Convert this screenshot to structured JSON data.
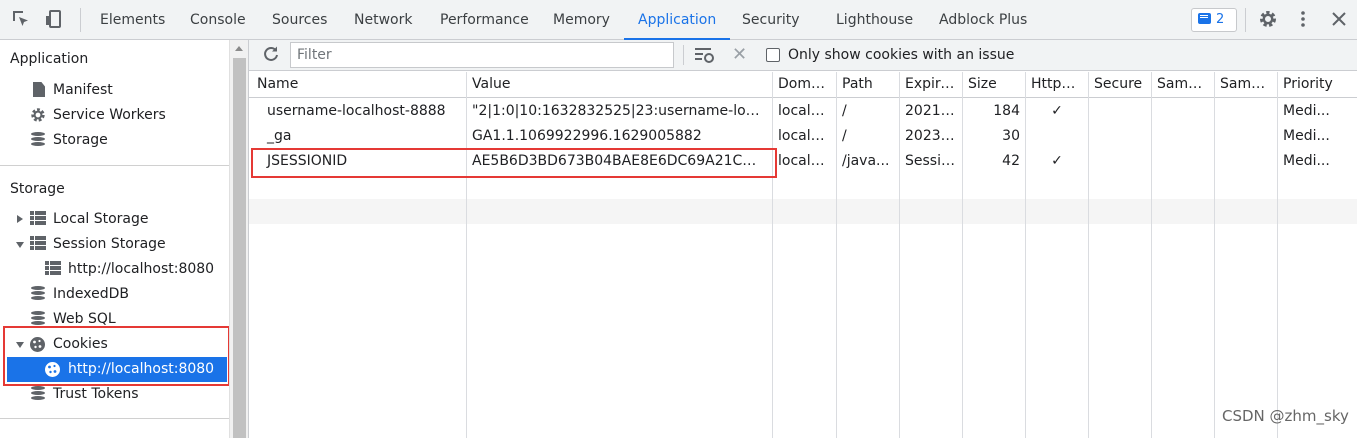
{
  "tabs": [
    "Elements",
    "Console",
    "Sources",
    "Network",
    "Performance",
    "Memory",
    "Application",
    "Security",
    "Lighthouse",
    "Adblock Plus"
  ],
  "active_tab": "Application",
  "issues_count": "2",
  "sidebar": {
    "section_application": "Application",
    "manifest": "Manifest",
    "service_workers": "Service Workers",
    "storage": "Storage",
    "section_storage": "Storage",
    "local_storage": "Local Storage",
    "session_storage": "Session Storage",
    "session_origin": "http://localhost:8080",
    "indexeddb": "IndexedDB",
    "websql": "Web SQL",
    "cookies": "Cookies",
    "cookies_origin": "http://localhost:8080",
    "trust_tokens": "Trust Tokens"
  },
  "toolbar": {
    "filter_placeholder": "Filter",
    "only_issues_label": "Only show cookies with an issue"
  },
  "table": {
    "columns": [
      "Name",
      "Value",
      "Domain",
      "Path",
      "Expire...",
      "Size",
      "HttpO...",
      "Secure",
      "Same...",
      "Same...",
      "Priority"
    ],
    "rows": [
      [
        "username-localhost-8888",
        "\"2|1:0|10:1632832525|23:username-localho...",
        "localh...",
        "/",
        "2021-...",
        "184",
        "✓",
        "",
        "",
        "",
        "Medi..."
      ],
      [
        "_ga",
        "GA1.1.1069922996.1629005882",
        "localh...",
        "/",
        "2023-...",
        "30",
        "",
        "",
        "",
        "",
        "Medi..."
      ],
      [
        "JSESSIONID",
        "AE5B6D3BD673B04BAE8E6DC69A21C672",
        "localh...",
        "/java...",
        "Session",
        "42",
        "✓",
        "",
        "",
        "",
        "Medi..."
      ]
    ]
  },
  "watermark": "CSDN @zhm_sky",
  "colors": {
    "accent": "#1a73e8",
    "highlight": "#e53935"
  }
}
